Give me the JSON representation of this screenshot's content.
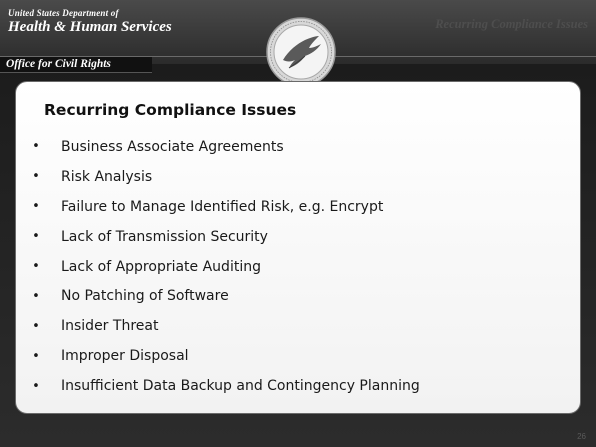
{
  "header": {
    "agency_line1": "United States Department of",
    "agency_line2": "Health & Human Services",
    "office": "Office for Civil Rights",
    "slide_title": "Recurring Compliance Issues"
  },
  "content": {
    "title": "Recurring Compliance Issues",
    "bullet_glyph": "•",
    "items": [
      "Business Associate Agreements",
      "Risk Analysis",
      "Failure to Manage Identified Risk, e.g. Encrypt",
      "Lack of Transmission Security",
      "Lack of Appropriate Auditing",
      "No Patching of Software",
      "Insider Threat",
      "Improper Disposal",
      "Insufficient Data Backup and Contingency Planning"
    ]
  },
  "footer": {
    "page_number": "26"
  },
  "colors": {
    "background": "#222222",
    "panel": "#ffffff",
    "text": "#1a1a1a"
  }
}
